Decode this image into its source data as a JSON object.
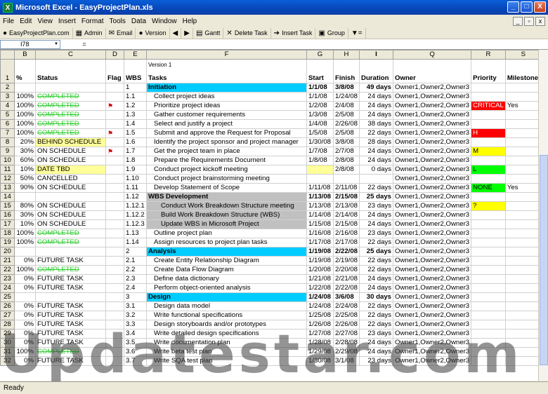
{
  "window": {
    "title": "Microsoft Excel - EasyProjectPlan.xls",
    "minimize": "_",
    "maximize": "□",
    "close": "X"
  },
  "menu": [
    "File",
    "Edit",
    "View",
    "Insert",
    "Format",
    "Tools",
    "Data",
    "Window",
    "Help"
  ],
  "toolbar": [
    {
      "icon": "globe-icon",
      "glyph": "●",
      "label": "EasyProjectPlan.com"
    },
    {
      "icon": "admin-icon",
      "glyph": "▦",
      "label": "Admin"
    },
    {
      "icon": "email-icon",
      "glyph": "✉",
      "label": "Email"
    },
    {
      "icon": "info-icon",
      "glyph": "●",
      "label": "Version"
    },
    {
      "icon": "arrow-left-icon",
      "glyph": "◀",
      "label": ""
    },
    {
      "icon": "arrow-right-icon",
      "glyph": "▶",
      "label": ""
    },
    {
      "icon": "gantt-icon",
      "glyph": "▤",
      "label": "Gantt"
    },
    {
      "icon": "delete-icon",
      "glyph": "✕",
      "label": "Delete Task"
    },
    {
      "icon": "insert-icon",
      "glyph": "➔",
      "label": "Insert Task"
    },
    {
      "icon": "group-icon",
      "glyph": "▣",
      "label": "Group"
    },
    {
      "icon": "filter-icon",
      "glyph": "▼=",
      "label": ""
    }
  ],
  "formula": {
    "name_box": "I78",
    "fx": "=",
    "value": ""
  },
  "columns": [
    "B",
    "C",
    "D",
    "E",
    "F",
    "G",
    "H",
    "I",
    "Q",
    "R",
    "S"
  ],
  "version": "Version 1",
  "headers": {
    "pct": "%",
    "status": "Status",
    "flag": "Flag",
    "wbs": "WBS",
    "tasks": "Tasks",
    "start": "Start",
    "finish": "Finish",
    "duration": "Duration",
    "owner": "Owner",
    "priority": "Priority",
    "milestone": "Milestone"
  },
  "rows": [
    {
      "row": "2",
      "pct": "",
      "status": "",
      "flag": "",
      "wbs": "1",
      "task": "Initiation",
      "start": "1/1/08",
      "finish": "3/8/08",
      "duration": "49 days",
      "owner": "Owner1,Owner2,Owner3",
      "priority": "",
      "milestone": "",
      "type": "phase"
    },
    {
      "row": "3",
      "pct": "100%",
      "status": "COMPLETED",
      "flag": "",
      "wbs": "1.1",
      "task": "Collect project ideas",
      "start": "1/1/08",
      "finish": "1/24/08",
      "duration": "24 days",
      "owner": "Owner1,Owner2,Owner3",
      "priority": "",
      "milestone": ""
    },
    {
      "row": "4",
      "pct": "100%",
      "status": "COMPLETED",
      "flag": "⚑",
      "wbs": "1.2",
      "task": "Prioritize project ideas",
      "start": "1/2/08",
      "finish": "2/4/08",
      "duration": "24 days",
      "owner": "Owner1,Owner2,Owner3",
      "priority": "CRITICAL",
      "milestone": "Yes"
    },
    {
      "row": "5",
      "pct": "100%",
      "status": "COMPLETED",
      "flag": "",
      "wbs": "1.3",
      "task": "Gather customer requirements",
      "start": "1/3/08",
      "finish": "2/5/08",
      "duration": "24 days",
      "owner": "Owner1,Owner2,Owner3",
      "priority": "",
      "milestone": ""
    },
    {
      "row": "6",
      "pct": "100%",
      "status": "COMPLETED",
      "flag": "",
      "wbs": "1.4",
      "task": "Select and justify a project",
      "start": "1/4/08",
      "finish": "2/26/08",
      "duration": "38 days",
      "owner": "Owner1,Owner2,Owner3",
      "priority": "",
      "milestone": ""
    },
    {
      "row": "7",
      "pct": "100%",
      "status": "COMPLETED",
      "flag": "⚑",
      "wbs": "1.5",
      "task": "Submit and approve the Request for Proposal",
      "start": "1/5/08",
      "finish": "2/5/08",
      "duration": "22 days",
      "owner": "Owner1,Owner2,Owner3",
      "priority": "H",
      "milestone": ""
    },
    {
      "row": "8",
      "pct": "20%",
      "status": "BEHIND SCHEDULE",
      "flag": "",
      "wbs": "1.6",
      "task": "Identify the project sponsor and project manager",
      "start": "1/30/08",
      "finish": "3/8/08",
      "duration": "28 days",
      "owner": "Owner1,Owner2,Owner3",
      "priority": "",
      "milestone": ""
    },
    {
      "row": "9",
      "pct": "30%",
      "status": "ON SCHEDULE",
      "flag": "⚑",
      "wbs": "1.7",
      "task": "Get the project team in place",
      "start": "1/7/08",
      "finish": "2/7/08",
      "duration": "24 days",
      "owner": "Owner1,Owner2,Owner3",
      "priority": "M",
      "milestone": ""
    },
    {
      "row": "10",
      "pct": "60%",
      "status": "ON SCHEDULE",
      "flag": "",
      "wbs": "1.8",
      "task": "Prepare the Requirements Document",
      "start": "1/8/08",
      "finish": "2/8/08",
      "duration": "24 days",
      "owner": "Owner1,Owner2,Owner3",
      "priority": "",
      "milestone": ""
    },
    {
      "row": "11",
      "pct": "10%",
      "status": "DATE TBD",
      "flag": "",
      "wbs": "1.9",
      "task": "Conduct project kickoff meeting",
      "start": "",
      "finish": "2/8/08",
      "duration": "0 days",
      "owner": "Owner1,Owner2,Owner3",
      "priority": "L",
      "milestone": ""
    },
    {
      "row": "12",
      "pct": "50%",
      "status": "CANCELLED",
      "flag": "",
      "wbs": "1.10",
      "task": "Conduct project brainstorming meeting",
      "start": "",
      "finish": "",
      "duration": "",
      "owner": "Owner1,Owner2,Owner3",
      "priority": "",
      "milestone": ""
    },
    {
      "row": "13",
      "pct": "90%",
      "status": "ON SCHEDULE",
      "flag": "",
      "wbs": "1.11",
      "task": "Develop Statement of Scope",
      "start": "1/11/08",
      "finish": "2/11/08",
      "duration": "22 days",
      "owner": "Owner1,Owner2,Owner3",
      "priority": "NONE",
      "milestone": "Yes"
    },
    {
      "row": "14",
      "pct": "",
      "status": "",
      "flag": "",
      "wbs": "1.12",
      "task": "WBS Development",
      "start": "1/13/08",
      "finish": "2/15/08",
      "duration": "25 days",
      "owner": "Owner1,Owner2,Owner3",
      "priority": "",
      "milestone": "",
      "type": "wbsdev"
    },
    {
      "row": "15",
      "pct": "80%",
      "status": "ON SCHEDULE",
      "flag": "",
      "wbs": "1.12.1",
      "task": "Conduct Work Breakdown Structure meeting",
      "start": "1/13/08",
      "finish": "2/13/08",
      "duration": "23 days",
      "owner": "Owner1,Owner2,Owner3",
      "priority": "?",
      "milestone": "",
      "type": "sub"
    },
    {
      "row": "16",
      "pct": "30%",
      "status": "ON SCHEDULE",
      "flag": "",
      "wbs": "1.12.2",
      "task": "Build Work Breakdown Structure (WBS)",
      "start": "1/14/08",
      "finish": "2/14/08",
      "duration": "24 days",
      "owner": "Owner1,Owner2,Owner3",
      "priority": "",
      "milestone": "",
      "type": "sub"
    },
    {
      "row": "17",
      "pct": "10%",
      "status": "ON SCHEDULE",
      "flag": "",
      "wbs": "1.12.3",
      "task": "Update WBS in Microsoft Project",
      "start": "1/15/08",
      "finish": "2/15/08",
      "duration": "24 days",
      "owner": "Owner1,Owner2,Owner3",
      "priority": "",
      "milestone": "",
      "type": "sub"
    },
    {
      "row": "18",
      "pct": "100%",
      "status": "COMPLETED",
      "flag": "",
      "wbs": "1.13",
      "task": "Outline project plan",
      "start": "1/16/08",
      "finish": "2/16/08",
      "duration": "23 days",
      "owner": "Owner1,Owner2,Owner3",
      "priority": "",
      "milestone": ""
    },
    {
      "row": "19",
      "pct": "100%",
      "status": "COMPLETED",
      "flag": "",
      "wbs": "1.14",
      "task": "Assign resources to project plan tasks",
      "start": "1/17/08",
      "finish": "2/17/08",
      "duration": "22 days",
      "owner": "Owner1,Owner2,Owner3",
      "priority": "",
      "milestone": ""
    },
    {
      "row": "20",
      "pct": "",
      "status": "",
      "flag": "",
      "wbs": "2",
      "task": "Analysis",
      "start": "1/19/08",
      "finish": "2/22/08",
      "duration": "25 days",
      "owner": "Owner1,Owner2,Owner3",
      "priority": "",
      "milestone": "",
      "type": "phase"
    },
    {
      "row": "21",
      "pct": "0%",
      "status": "FUTURE TASK",
      "flag": "",
      "wbs": "2.1",
      "task": "Create Entity Relationship Diagram",
      "start": "1/19/08",
      "finish": "2/19/08",
      "duration": "22 days",
      "owner": "Owner1,Owner2,Owner3",
      "priority": "",
      "milestone": ""
    },
    {
      "row": "22",
      "pct": "100%",
      "status": "COMPLETED",
      "flag": "",
      "wbs": "2.2",
      "task": "Create Data Flow Diagram",
      "start": "1/20/08",
      "finish": "2/20/08",
      "duration": "22 days",
      "owner": "Owner1,Owner2,Owner3",
      "priority": "",
      "milestone": ""
    },
    {
      "row": "23",
      "pct": "0%",
      "status": "FUTURE TASK",
      "flag": "",
      "wbs": "2.3",
      "task": "Define data dictionary",
      "start": "1/21/08",
      "finish": "2/21/08",
      "duration": "24 days",
      "owner": "Owner1,Owner2,Owner3",
      "priority": "",
      "milestone": ""
    },
    {
      "row": "24",
      "pct": "0%",
      "status": "FUTURE TASK",
      "flag": "",
      "wbs": "2.4",
      "task": "Perform object-oriented analysis",
      "start": "1/22/08",
      "finish": "2/22/08",
      "duration": "24 days",
      "owner": "Owner1,Owner2,Owner3",
      "priority": "",
      "milestone": ""
    },
    {
      "row": "25",
      "pct": "",
      "status": "",
      "flag": "",
      "wbs": "3",
      "task": "Design",
      "start": "1/24/08",
      "finish": "3/6/08",
      "duration": "30 days",
      "owner": "Owner1,Owner2,Owner3",
      "priority": "",
      "milestone": "",
      "type": "phase"
    },
    {
      "row": "26",
      "pct": "0%",
      "status": "FUTURE TASK",
      "flag": "",
      "wbs": "3.1",
      "task": "Design data model",
      "start": "1/24/08",
      "finish": "2/24/08",
      "duration": "22 days",
      "owner": "Owner1,Owner2,Owner3",
      "priority": "",
      "milestone": ""
    },
    {
      "row": "27",
      "pct": "0%",
      "status": "FUTURE TASK",
      "flag": "",
      "wbs": "3.2",
      "task": "Write functional specifications",
      "start": "1/25/08",
      "finish": "2/25/08",
      "duration": "22 days",
      "owner": "Owner1,Owner2,Owner3",
      "priority": "",
      "milestone": ""
    },
    {
      "row": "28",
      "pct": "0%",
      "status": "FUTURE TASK",
      "flag": "",
      "wbs": "3.3",
      "task": "Design storyboards and/or prototypes",
      "start": "1/26/08",
      "finish": "2/26/08",
      "duration": "22 days",
      "owner": "Owner1,Owner2,Owner3",
      "priority": "",
      "milestone": ""
    },
    {
      "row": "29",
      "pct": "0%",
      "status": "FUTURE TASK",
      "flag": "",
      "wbs": "3.4",
      "task": "Write detailed design specifications",
      "start": "1/27/08",
      "finish": "2/27/08",
      "duration": "23 days",
      "owner": "Owner1,Owner2,Owner3",
      "priority": "",
      "milestone": ""
    },
    {
      "row": "30",
      "pct": "0%",
      "status": "FUTURE TASK",
      "flag": "",
      "wbs": "3.5",
      "task": "Write documentation plan",
      "start": "1/28/08",
      "finish": "2/28/08",
      "duration": "24 days",
      "owner": "Owner1,Owner2,Owner3",
      "priority": "",
      "milestone": ""
    },
    {
      "row": "31",
      "pct": "100%",
      "status": "COMPLETED",
      "flag": "",
      "wbs": "3.6",
      "task": "Write beta test plan",
      "start": "1/29/08",
      "finish": "2/29/08",
      "duration": "24 days",
      "owner": "Owner1,Owner2,Owner3",
      "priority": "",
      "milestone": ""
    },
    {
      "row": "32",
      "pct": "0%",
      "status": "FUTURE TASK",
      "flag": "",
      "wbs": "3.7",
      "task": "Write SQA test plan",
      "start": "1/30/08",
      "finish": "3/1/08",
      "duration": "23 days",
      "owner": "Owner1,Owner2,Owner3",
      "priority": "",
      "milestone": ""
    }
  ],
  "status_bar": "Ready",
  "watermark": "Updatestar.com",
  "colors": {
    "phase": "#00ccff",
    "completed": "#33cc33",
    "critical": "#ff0000",
    "high": "#ff0000",
    "medium": "#ffff00",
    "low": "#00ff00",
    "none": "#00ff00",
    "unknown": "#ffff00",
    "behind": "#ffff99"
  }
}
